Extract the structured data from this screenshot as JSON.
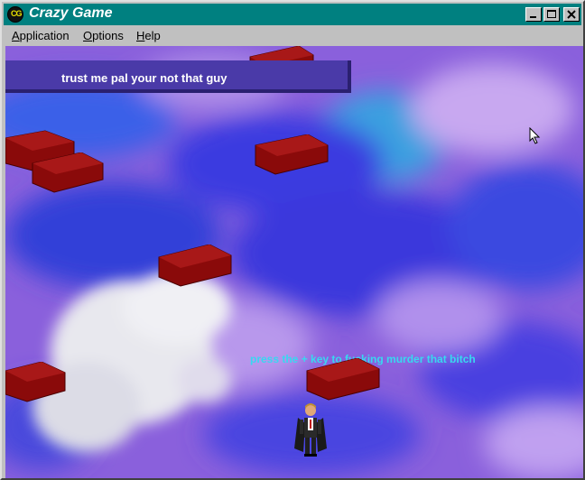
{
  "window": {
    "title": "Crazy Game",
    "icon": "game-logo-icon",
    "icon_text": "CG",
    "controls": [
      "minimize-icon",
      "maximize-icon",
      "close-icon"
    ]
  },
  "menu": {
    "items": [
      {
        "label": "Application",
        "accel": "A",
        "rest": "pplication"
      },
      {
        "label": "Options",
        "accel": "O",
        "rest": "ptions"
      },
      {
        "label": "Help",
        "accel": "H",
        "rest": "elp"
      }
    ]
  },
  "game": {
    "banner_text": "trust me pal your not that guy",
    "prompt_text": "press the + key to fucking murder that bitch",
    "colors": {
      "titlebar": "#008080",
      "sky_blue": "#3a44e0",
      "sky_purple": "#9a6ae0",
      "cloud_white": "#e8e8ee",
      "block_red": "#8a0a0a",
      "banner_bg": "#4a3aa8",
      "prompt_cyan": "#38d8f0"
    },
    "sprites": [
      "red-block",
      "player-character",
      "mouse-cursor-icon"
    ]
  }
}
